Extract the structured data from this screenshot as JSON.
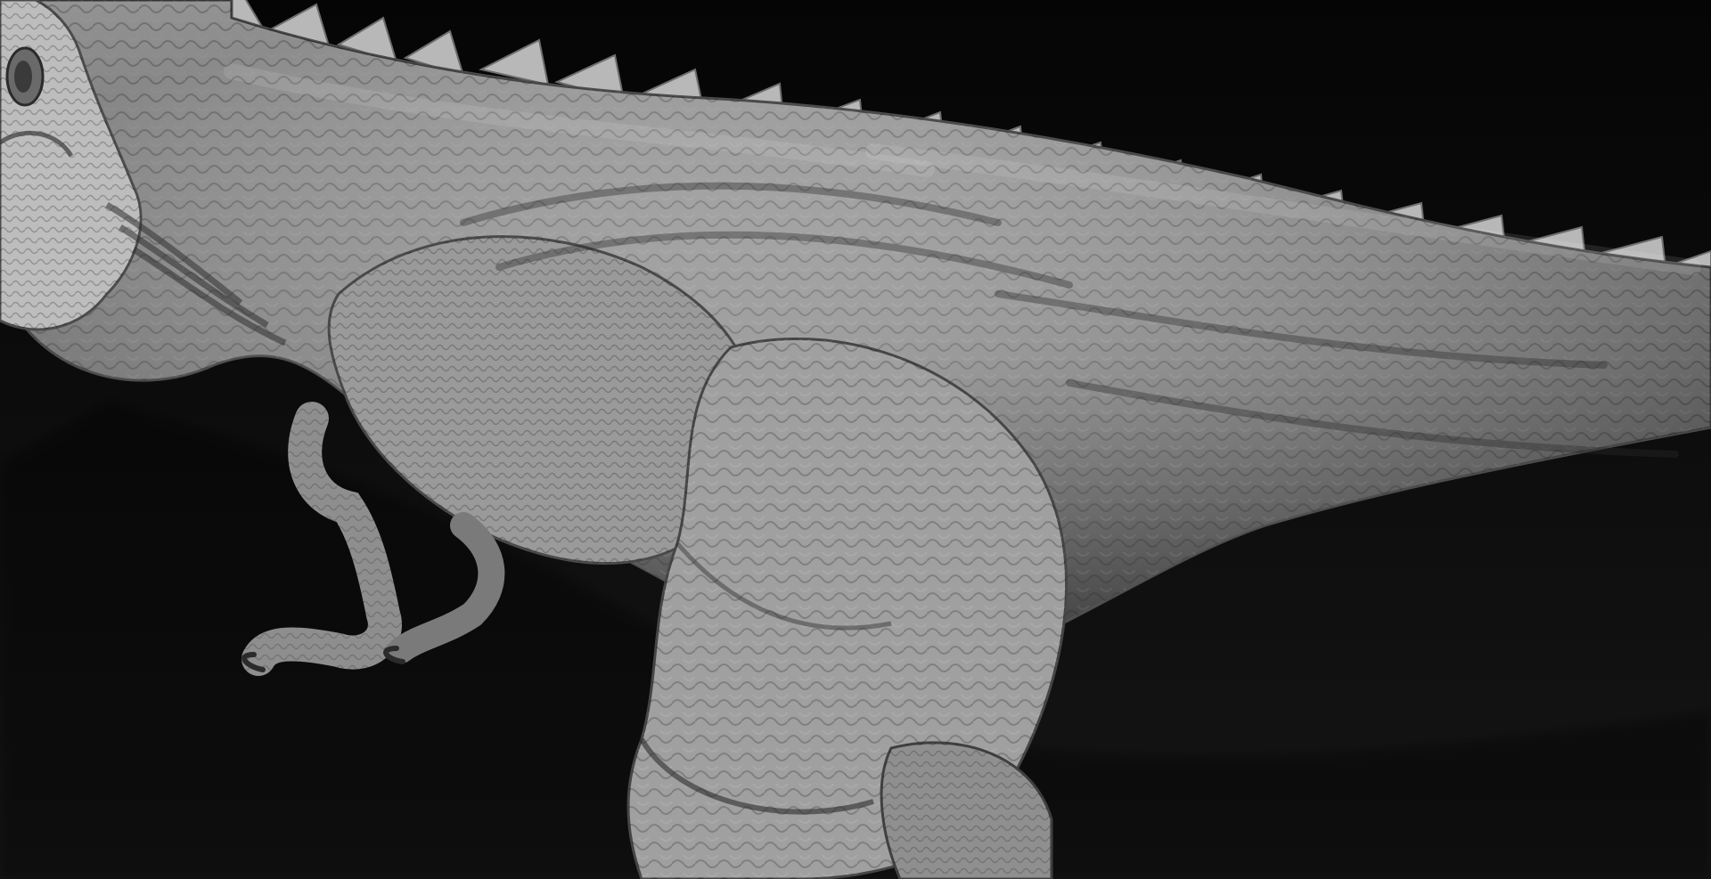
{
  "viewport": {
    "subject": "sculpted-creature-model",
    "material": "matcap-gray",
    "colors": {
      "background_top": "#050505",
      "background_bottom": "#151515",
      "skin_light": "#d7d7d7",
      "skin_mid": "#8c8c8c",
      "skin_dark": "#2f2f2f"
    }
  }
}
